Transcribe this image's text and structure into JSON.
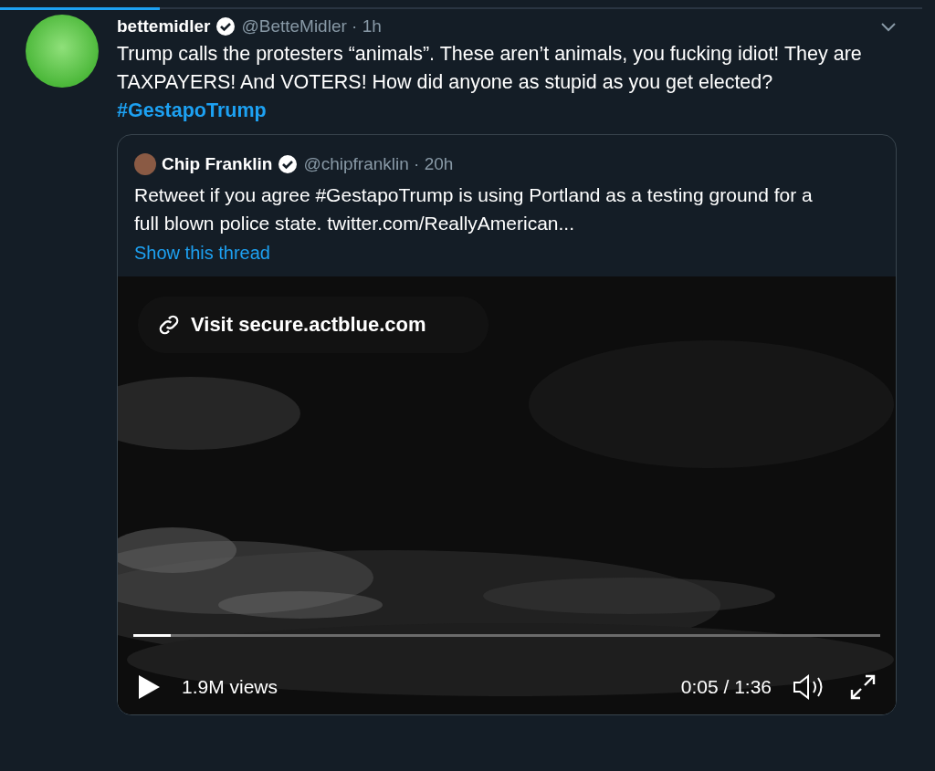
{
  "tweet": {
    "author": "bettemidler",
    "verified": true,
    "handle": "@BetteMidler · 1h",
    "text": [
      {
        "kind": "text",
        "text": "Trump calls the protesters “animals”.  These aren’t animals, you fucking idiot! They are TAXPAYERS! And VOTERS!  How did anyone as stupid as you get elected? "
      },
      {
        "kind": "hashtag",
        "text": "#GestapoTrump"
      }
    ],
    "quote": {
      "author": "Chip Franklin",
      "verified": true,
      "handle": "@chipfranklin · 20h",
      "text": "Retweet if you agree #GestapoTrump is using Portland as a testing ground for a full blown police state. twitter.com/ReallyAmerican...",
      "thread_link": "Show this thread",
      "video": {
        "kind": "picture",
        "link": "Visit secure.actblue.com",
        "progress": {
          "level": 0.05
        },
        "views": "1.9M views",
        "time": "0:05 / 1:36"
      }
    }
  }
}
